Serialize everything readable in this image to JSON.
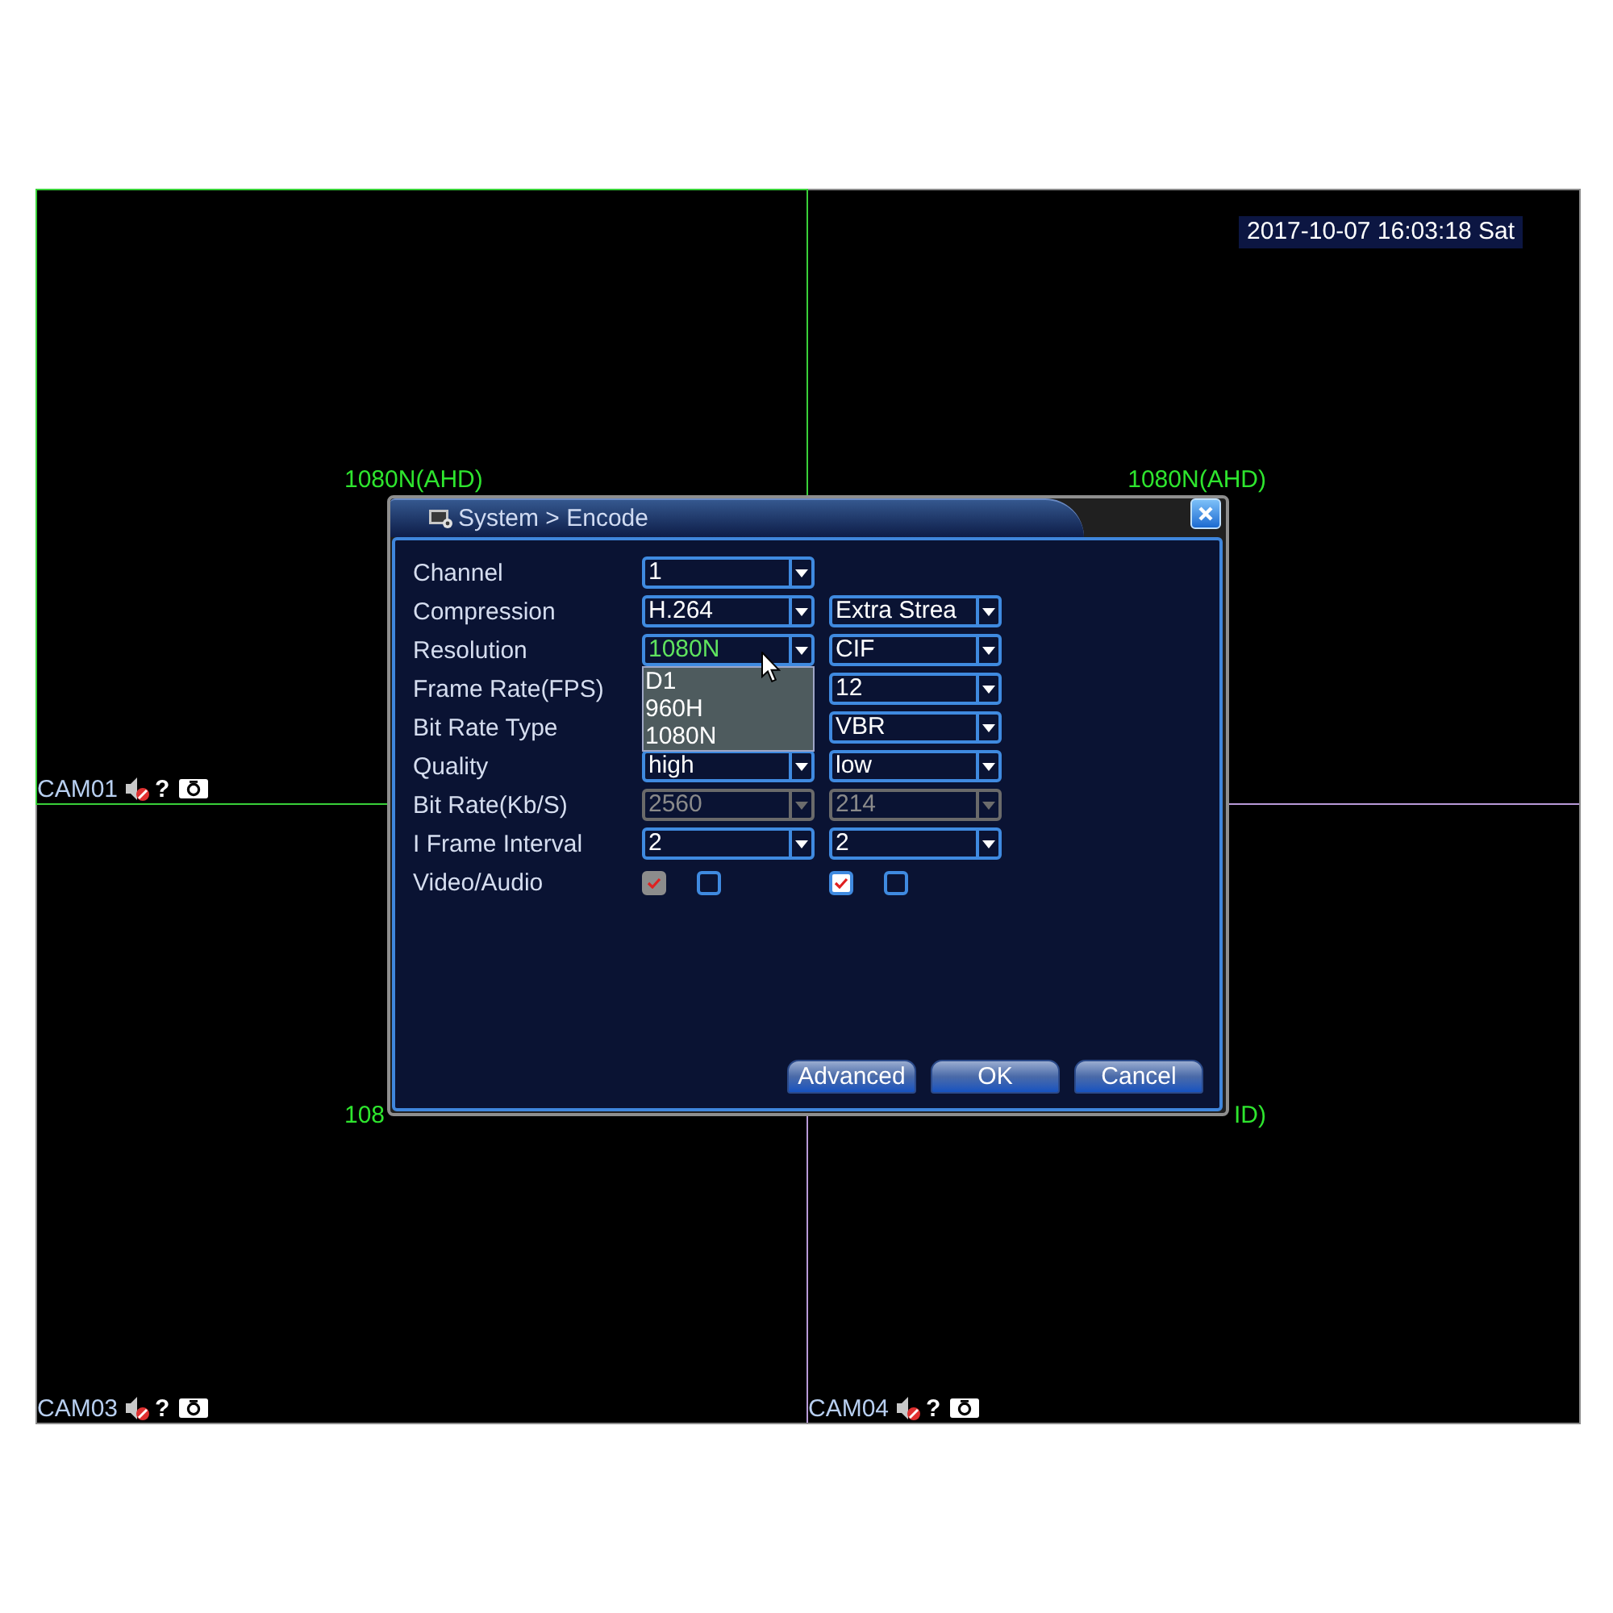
{
  "quadrants": [
    {
      "selected": true,
      "resolution": "1080N(AHD)",
      "camera": {
        "name": "CAM01",
        "symbol": "?"
      }
    },
    {
      "selected": false,
      "timestamp": "2017-10-07 16:03:18 Sat",
      "resolution": "1080N(AHD)"
    },
    {
      "selected": false,
      "resolution": "108",
      "camera": {
        "name": "CAM03",
        "symbol": "?"
      }
    },
    {
      "selected": false,
      "resolution": "ID)",
      "camera": {
        "name": "CAM04",
        "symbol": "?"
      }
    }
  ],
  "dialog": {
    "title": "System > Encode",
    "rows": [
      {
        "label": "Channel",
        "column_1": {
          "kind": "select",
          "value": "1",
          "disabled": false,
          "open": false
        }
      },
      {
        "label": "Compression",
        "column_1": {
          "kind": "select",
          "value": "H.264",
          "disabled": false,
          "open": false
        },
        "column_2": {
          "kind": "select",
          "value": "Extra Strea",
          "disabled": false,
          "open": false
        }
      },
      {
        "label": "Resolution",
        "column_1": {
          "kind": "select",
          "value": "1080N",
          "disabled": false,
          "open": true,
          "options": [
            "D1",
            "960H",
            "1080N"
          ]
        },
        "column_2": {
          "kind": "select",
          "value": "CIF",
          "disabled": false,
          "open": false
        }
      },
      {
        "label": "Frame Rate(FPS)",
        "column_2": {
          "kind": "select",
          "value": "12",
          "disabled": false,
          "open": false
        }
      },
      {
        "label": "Bit Rate Type",
        "column_2": {
          "kind": "select",
          "value": "VBR",
          "disabled": false,
          "open": false
        }
      },
      {
        "label": "Quality",
        "column_1": {
          "kind": "select",
          "value": "high",
          "disabled": false,
          "open": false
        },
        "column_2": {
          "kind": "select",
          "value": "low",
          "disabled": false,
          "open": false
        }
      },
      {
        "label": "Bit Rate(Kb/S)",
        "column_1": {
          "kind": "select",
          "value": "2560",
          "disabled": true,
          "open": false
        },
        "column_2": {
          "kind": "select",
          "value": "214",
          "disabled": true,
          "open": false
        }
      },
      {
        "label": "I Frame Interval",
        "column_1": {
          "kind": "select",
          "value": "2",
          "disabled": false,
          "open": false
        },
        "column_2": {
          "kind": "select",
          "value": "2",
          "disabled": false,
          "open": false
        }
      },
      {
        "label": "Video/Audio",
        "column_1": {
          "kind": "checkboxes",
          "items": [
            {
              "checked": true,
              "disabled": true
            },
            {
              "checked": false,
              "disabled": false
            }
          ]
        },
        "column_2": {
          "kind": "checkboxes",
          "items": [
            {
              "checked": true,
              "disabled": false
            },
            {
              "checked": false,
              "disabled": false
            }
          ]
        }
      }
    ],
    "buttons": [
      "Advanced",
      "OK",
      "Cancel"
    ]
  }
}
